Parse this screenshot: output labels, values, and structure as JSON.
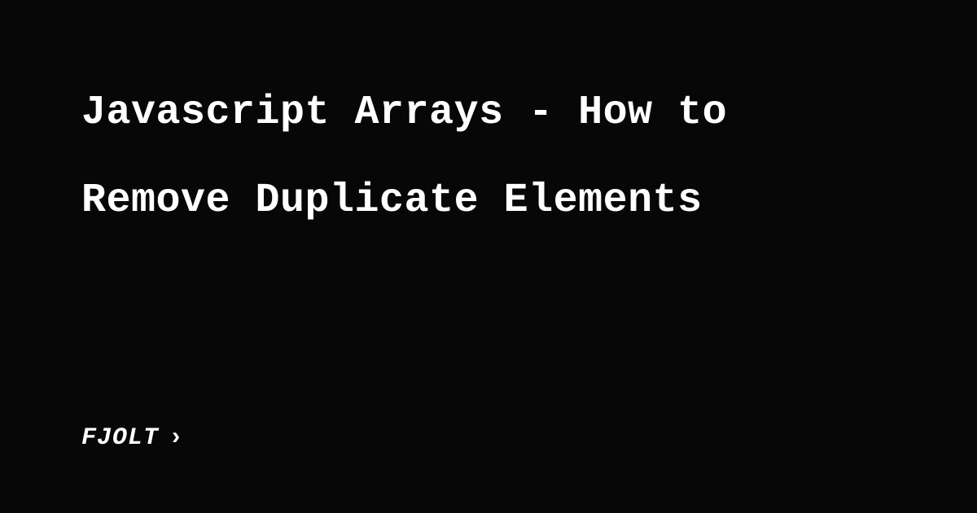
{
  "title": "Javascript Arrays - How to Remove Duplicate Elements",
  "brand": {
    "name": "FJOLT",
    "chevron": "›"
  },
  "colors": {
    "background": "#070707",
    "text": "#ffffff"
  }
}
